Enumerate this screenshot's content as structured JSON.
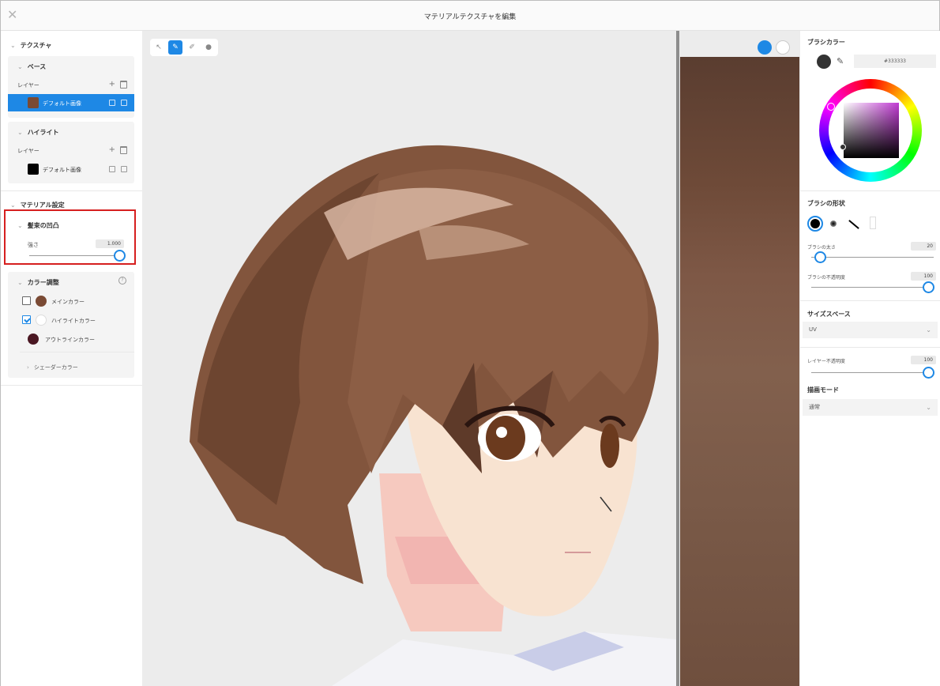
{
  "window": {
    "title": "マテリアルテクスチャを編集",
    "close_icon": "close-icon"
  },
  "left_panel": {
    "texture_section": "テクスチャ",
    "base": {
      "title": "ベース",
      "layer_label": "レイヤー",
      "item_name": "デフォルト画像",
      "item_color": "#7a4a34"
    },
    "highlight": {
      "title": "ハイライト",
      "layer_label": "レイヤー",
      "item_name": "デフォルト画像",
      "item_color": "#000000"
    },
    "material_section": "マテリアル設定",
    "hair_bump": {
      "title": "髪束の凹凸",
      "strength_label": "強さ",
      "strength_value": "1.000"
    },
    "color_adjust": {
      "title": "カラー調整",
      "rows": [
        {
          "label": "メインカラー",
          "checked": false,
          "color": "#7a4a34"
        },
        {
          "label": "ハイライトカラー",
          "checked": true,
          "color": "#ffffff"
        },
        {
          "label": "アウトラインカラー",
          "checked": null,
          "color": "#4a1722"
        }
      ],
      "shader_color": "シェーダーカラー"
    }
  },
  "viewport": {
    "tools": [
      "cursor-icon",
      "brush-icon",
      "eraser-icon",
      "fill-icon"
    ],
    "active_tool": "brush-icon"
  },
  "right_panel": {
    "brush_color_label": "ブラシカラー",
    "brush_color_hex": "#333333",
    "brush_shape_label": "ブラシの形状",
    "brush_size_label": "ブラシの太さ",
    "brush_size_value": "20",
    "brush_opacity_label": "ブラシの不透明度",
    "brush_opacity_value": "100",
    "size_space_label": "サイズスペース",
    "size_space_value": "UV",
    "layer_opacity_label": "レイヤー不透明度",
    "layer_opacity_value": "100",
    "draw_mode_label": "描画モード",
    "draw_mode_value": "通常"
  },
  "colors": {
    "accent": "#1e88e5",
    "highlight_box": "#d61f1f"
  }
}
